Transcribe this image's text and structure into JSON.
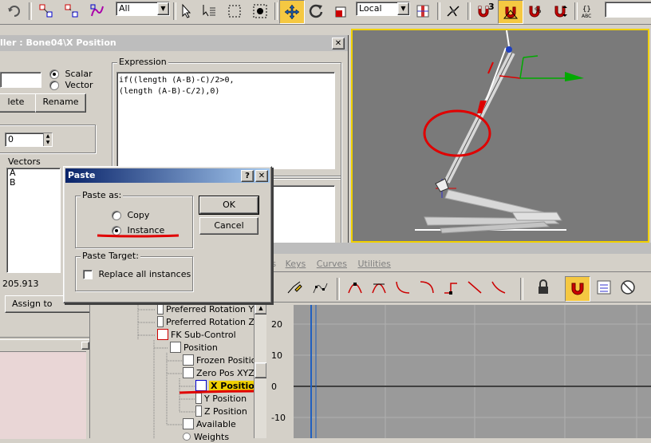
{
  "toolbar": {
    "filter_select": "All",
    "coord_select": "Local",
    "snap_angle_label": "3",
    "icons": [
      "undo-icon",
      "link-icon",
      "unlink-icon",
      "bind-spacewarp-icon",
      "select-icon",
      "select-by-name-icon",
      "rect-region-icon",
      "window-crossing-icon",
      "move-icon",
      "rotate-icon",
      "scale-icon",
      "pivot-icon",
      "snap-icon",
      "angle-snap-icon",
      "percent-snap-icon",
      "spinner-snap-icon",
      "named-selection-icon"
    ]
  },
  "controller_dialog": {
    "title": "ller : Bone04\\X Position",
    "close_label": "✕",
    "scalar_label": "Scalar",
    "vector_label": "Vector",
    "delete_label": "lete",
    "rename_label": "Rename",
    "spinner_value": "0",
    "expression_label": "Expression",
    "expression_line1": "if((length (A-B)-C)/2>0,",
    "expression_line2": "(length (A-B)-C/2),0)",
    "vectors_label": "Vectors",
    "vectors": [
      "A",
      "B"
    ],
    "value_readout": "205.913",
    "assign_label": "Assign to Controller"
  },
  "paste_dialog": {
    "title": "Paste",
    "help_label": "?",
    "close_label": "✕",
    "paste_as_label": "Paste as:",
    "copy_label": "Copy",
    "instance_label": "Instance",
    "ok_label": "OK",
    "cancel_label": "Cancel",
    "paste_target_label": "Paste Target:",
    "replace_label": "Replace all instances"
  },
  "curve_editor": {
    "menu": [
      "ks",
      "Keys",
      "Curves",
      "Utilities"
    ],
    "y_ticks": [
      "20",
      "10",
      "0",
      "-10"
    ]
  },
  "tree": [
    {
      "label": "Preferred Rotation Y"
    },
    {
      "label": "Preferred Rotation Z"
    },
    {
      "label": "FK Sub-Control"
    },
    {
      "label": "Position"
    },
    {
      "label": "Frozen Position"
    },
    {
      "label": "Zero Pos XYZ"
    },
    {
      "label": "X Position"
    },
    {
      "label": "Y Position"
    },
    {
      "label": "Z Position"
    },
    {
      "label": "Available"
    },
    {
      "label": "Weights"
    }
  ],
  "colors": {
    "viewport_bg": "#7a7a7a",
    "active_viewport_border": "#f0d000",
    "annotation_red": "#e00000",
    "title_active": "#0a246a",
    "title_inactive": "#808080"
  }
}
